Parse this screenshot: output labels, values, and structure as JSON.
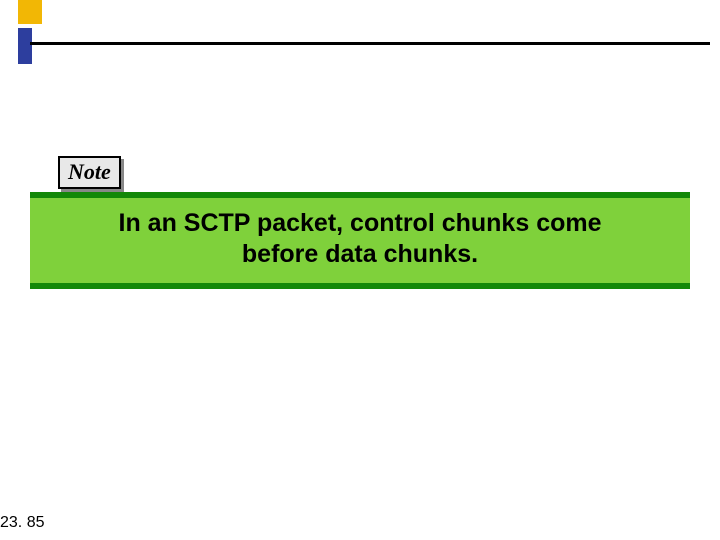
{
  "header": {
    "note_label": "Note"
  },
  "banner": {
    "line1": "In an SCTP packet, control chunks come",
    "line2": "before data chunks."
  },
  "page": {
    "number": "23. 85"
  },
  "colors": {
    "gold": "#f2b705",
    "blue": "#2d3e9e",
    "banner_bar": "#138808",
    "banner_fill": "#7fd13b"
  }
}
